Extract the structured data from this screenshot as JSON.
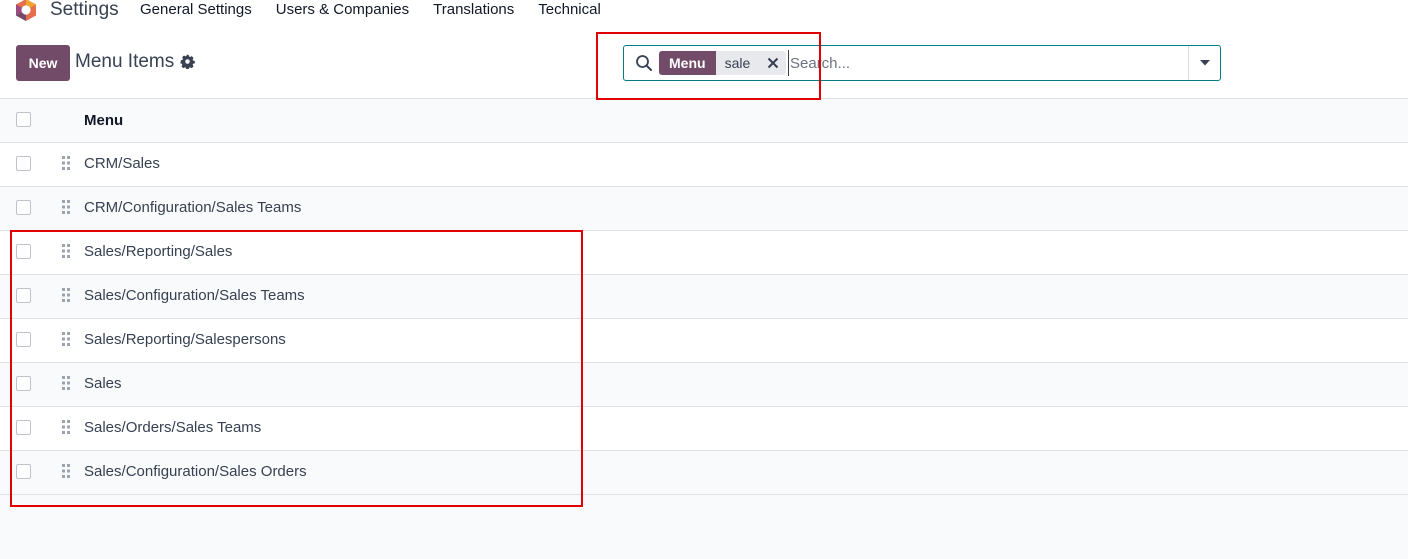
{
  "navbar": {
    "app_name": "Settings",
    "menu": [
      "General Settings",
      "Users & Companies",
      "Translations",
      "Technical"
    ]
  },
  "control_panel": {
    "new_label": "New",
    "title": "Menu Items"
  },
  "search": {
    "facet_label": "Menu",
    "facet_value": "sale",
    "placeholder": "Search..."
  },
  "list": {
    "column_header": "Menu",
    "rows": [
      "CRM/Sales",
      "CRM/Configuration/Sales Teams",
      "Sales/Reporting/Sales",
      "Sales/Configuration/Sales Teams",
      "Sales/Reporting/Salespersons",
      "Sales",
      "Sales/Orders/Sales Teams",
      "Sales/Configuration/Sales Orders"
    ]
  },
  "colors": {
    "brand": "#714b67",
    "accent": "#017e84",
    "highlight": "#e00000"
  },
  "icons": [
    "app-logo-icon",
    "gear-icon",
    "search-icon",
    "close-icon",
    "caret-down-icon",
    "drag-handle-icon"
  ]
}
